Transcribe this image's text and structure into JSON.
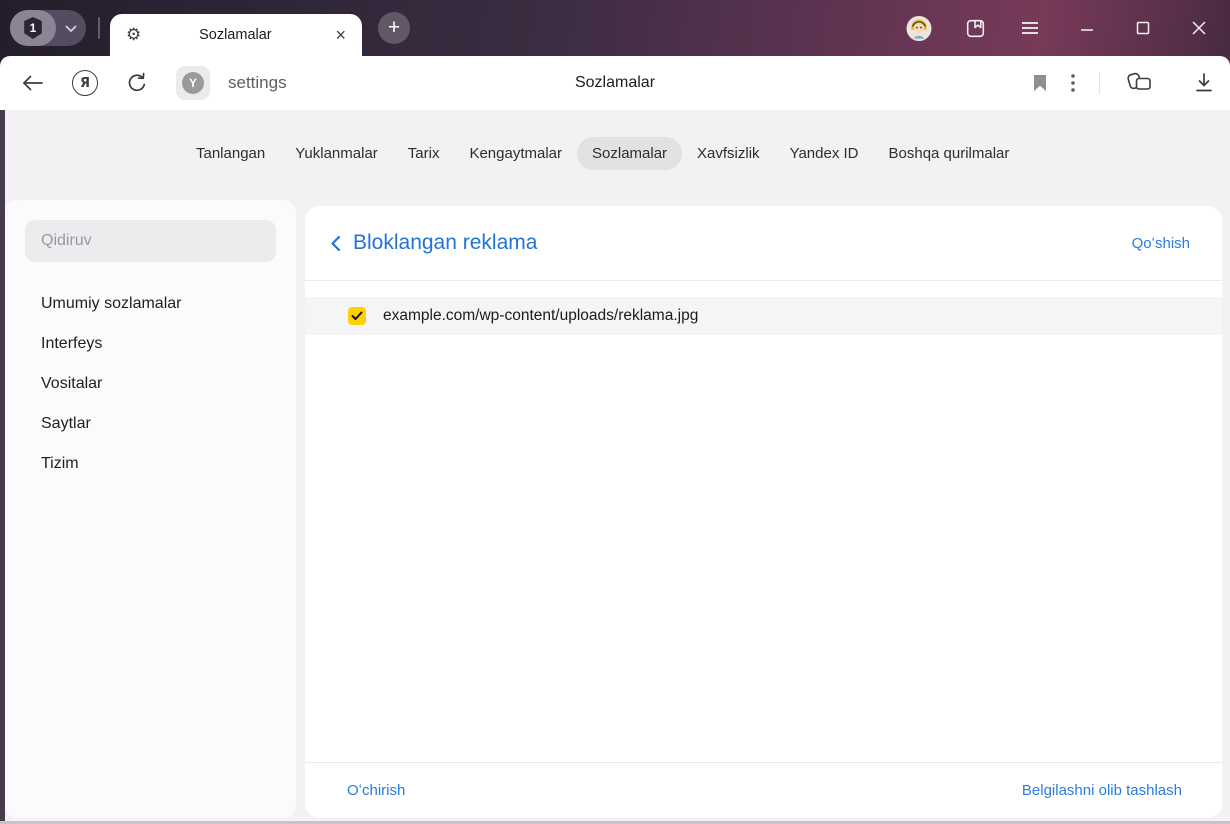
{
  "theme": {
    "accent_blue": "#1f74d4",
    "link_blue": "#2a7ce0",
    "checkbox_yellow": "#fcd200",
    "topbar_dark": "#241d2b",
    "topbar_wine": "#773a59",
    "selected_tab_pill": "#e3e1e4"
  },
  "titlebar": {
    "tab_count": "1",
    "tab_title": "Sozlamalar"
  },
  "icons": {
    "gear_glyph": "⚙",
    "tab_close_glyph": "×",
    "new_tab_glyph": "+",
    "yandex_logo_glyph": "Я",
    "site_badge_glyph": "Y"
  },
  "addressbar": {
    "url": "settings",
    "page_title": "Sozlamalar"
  },
  "tabs": {
    "selected": "Sozlamalar",
    "items": [
      "Tanlangan",
      "Yuklanmalar",
      "Tarix",
      "Kengaytmalar",
      "Sozlamalar",
      "Xavfsizlik",
      "Yandex ID",
      "Boshqa qurilmalar"
    ]
  },
  "sidebar": {
    "search_placeholder": "Qidiruv",
    "items": [
      "Umumiy sozlamalar",
      "Interfeys",
      "Vositalar",
      "Saytlar",
      "Tizim"
    ]
  },
  "main": {
    "title": "Bloklangan reklama",
    "add_label": "Qoʻshish",
    "items": [
      {
        "url": "example.com/wp-content/uploads/reklama.jpg",
        "checked": true
      }
    ],
    "delete_label": "Oʻchirish",
    "clear_selection_label": "Belgilashni olib tashlash"
  }
}
